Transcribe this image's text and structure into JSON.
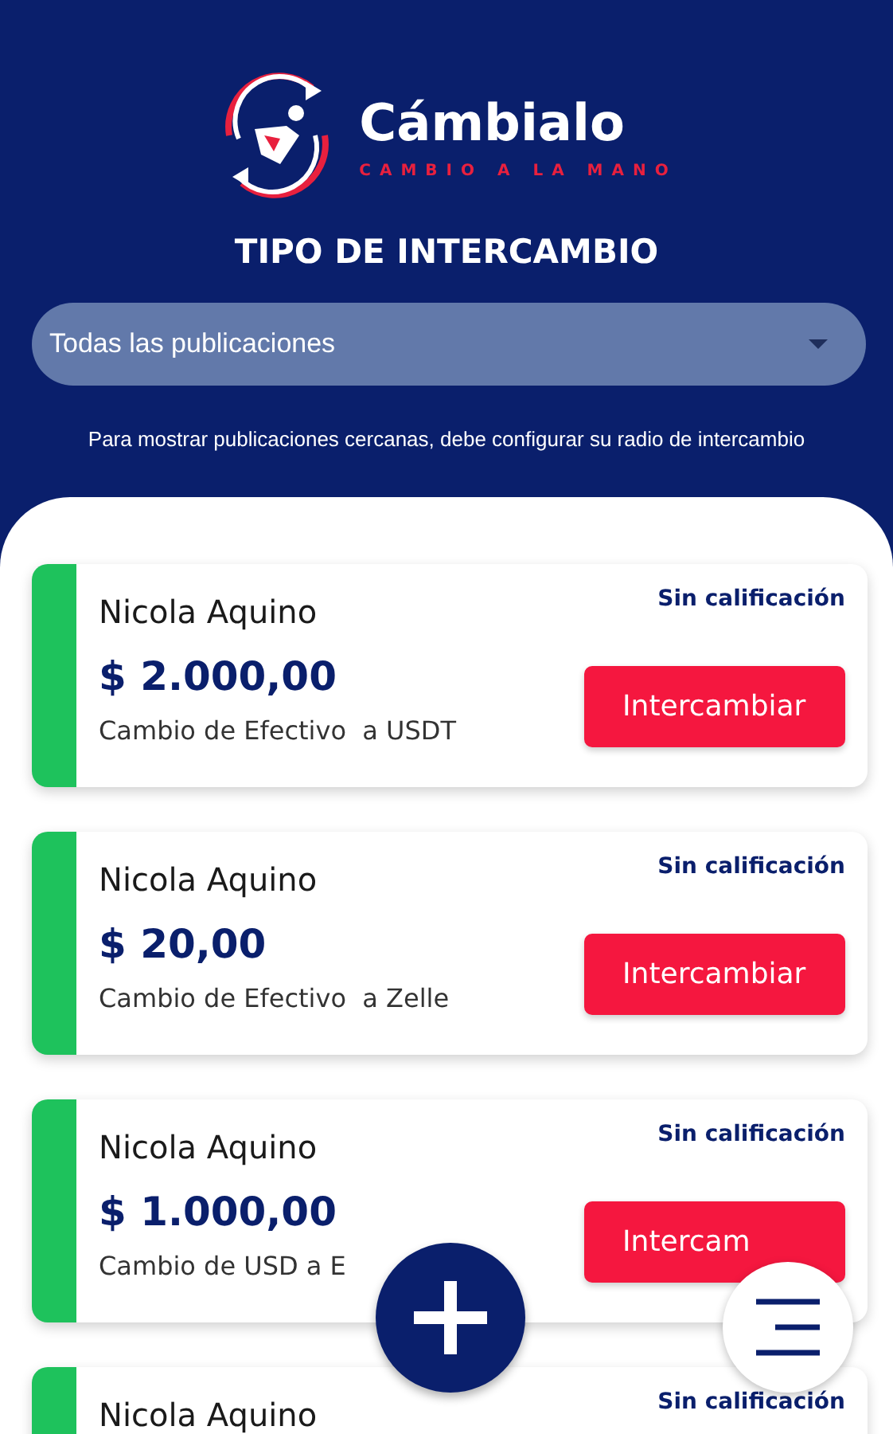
{
  "logo": {
    "name": "Cámbialo",
    "tagline": "CAMBIO A LA MANO"
  },
  "title": "TIPO DE INTERCAMBIO",
  "filter": {
    "value": "Todas las publicaciones"
  },
  "note": "Para mostrar publicaciones cercanas, debe configurar su radio de intercambio",
  "offers": [
    {
      "name": "Nicola Aquino",
      "rating": "Sin calificación",
      "amount": "$ 2.000,00",
      "description": "Cambio de Efectivo  a USDT",
      "action": "Intercambiar"
    },
    {
      "name": "Nicola Aquino",
      "rating": "Sin calificación",
      "amount": "$ 20,00",
      "description": "Cambio de Efectivo  a Zelle",
      "action": "Intercambiar"
    },
    {
      "name": "Nicola Aquino",
      "rating": "Sin calificación",
      "amount": "$ 1.000,00",
      "description": "Cambio de USD a E",
      "action": "Intercam"
    },
    {
      "name": "Nicola Aquino",
      "rating": "Sin calificación"
    }
  ]
}
